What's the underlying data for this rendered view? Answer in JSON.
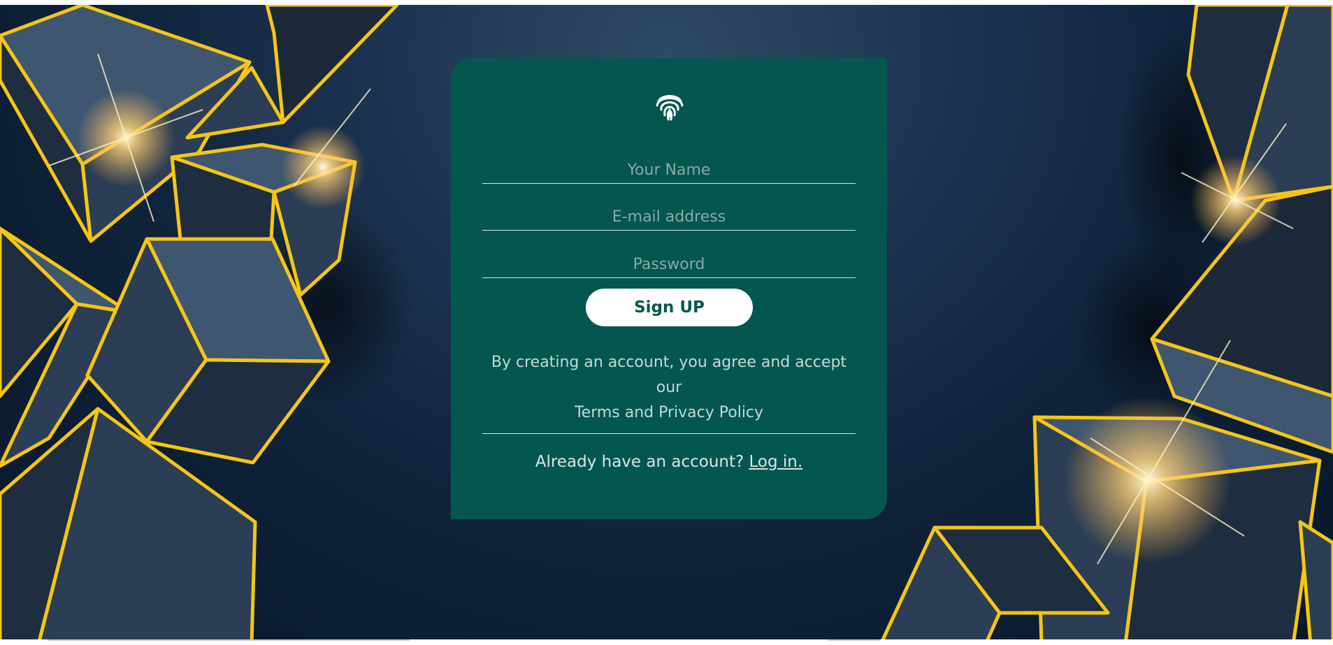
{
  "form": {
    "name_placeholder": "Your Name",
    "email_placeholder": "E-mail address",
    "password_placeholder": "Password",
    "signup_label": "Sign UP",
    "terms_line1": "By creating an account, you agree and accept our",
    "terms_line2": "Terms and Privacy Policy",
    "login_prompt": "Already have an account?",
    "login_link": "Log in."
  },
  "icons": {
    "logo": "fingerprint-icon"
  },
  "colors": {
    "card": "#03574f",
    "button_bg": "#ffffff",
    "button_text": "#03574f",
    "background": "#0e2239",
    "gold_edge": "#f5c518"
  }
}
